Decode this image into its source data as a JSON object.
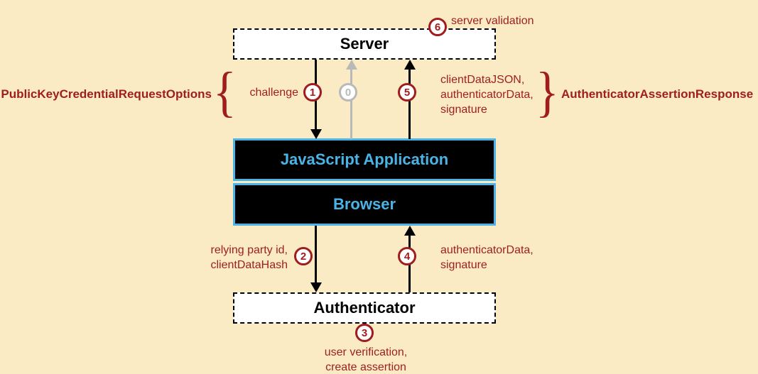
{
  "boxes": {
    "server": "Server",
    "jsapp": "JavaScript Application",
    "browser": "Browser",
    "authenticator": "Authenticator"
  },
  "side_labels": {
    "left_bold": "PublicKeyCredentialRequestOptions",
    "right_bold": "AuthenticatorAssertionResponse"
  },
  "steps": {
    "s0": "0",
    "s1": {
      "num": "1",
      "text": "challenge"
    },
    "s2": {
      "num": "2",
      "text": "relying party id,\nclientDataHash"
    },
    "s3": {
      "num": "3",
      "text": "user verification,\ncreate assertion"
    },
    "s4": {
      "num": "4",
      "text": "authenticatorData,\nsignature"
    },
    "s5": {
      "num": "5",
      "text": "clientDataJSON,\nauthenticatorData,\nsignature"
    },
    "s6": {
      "num": "6",
      "text": "server validation"
    }
  }
}
